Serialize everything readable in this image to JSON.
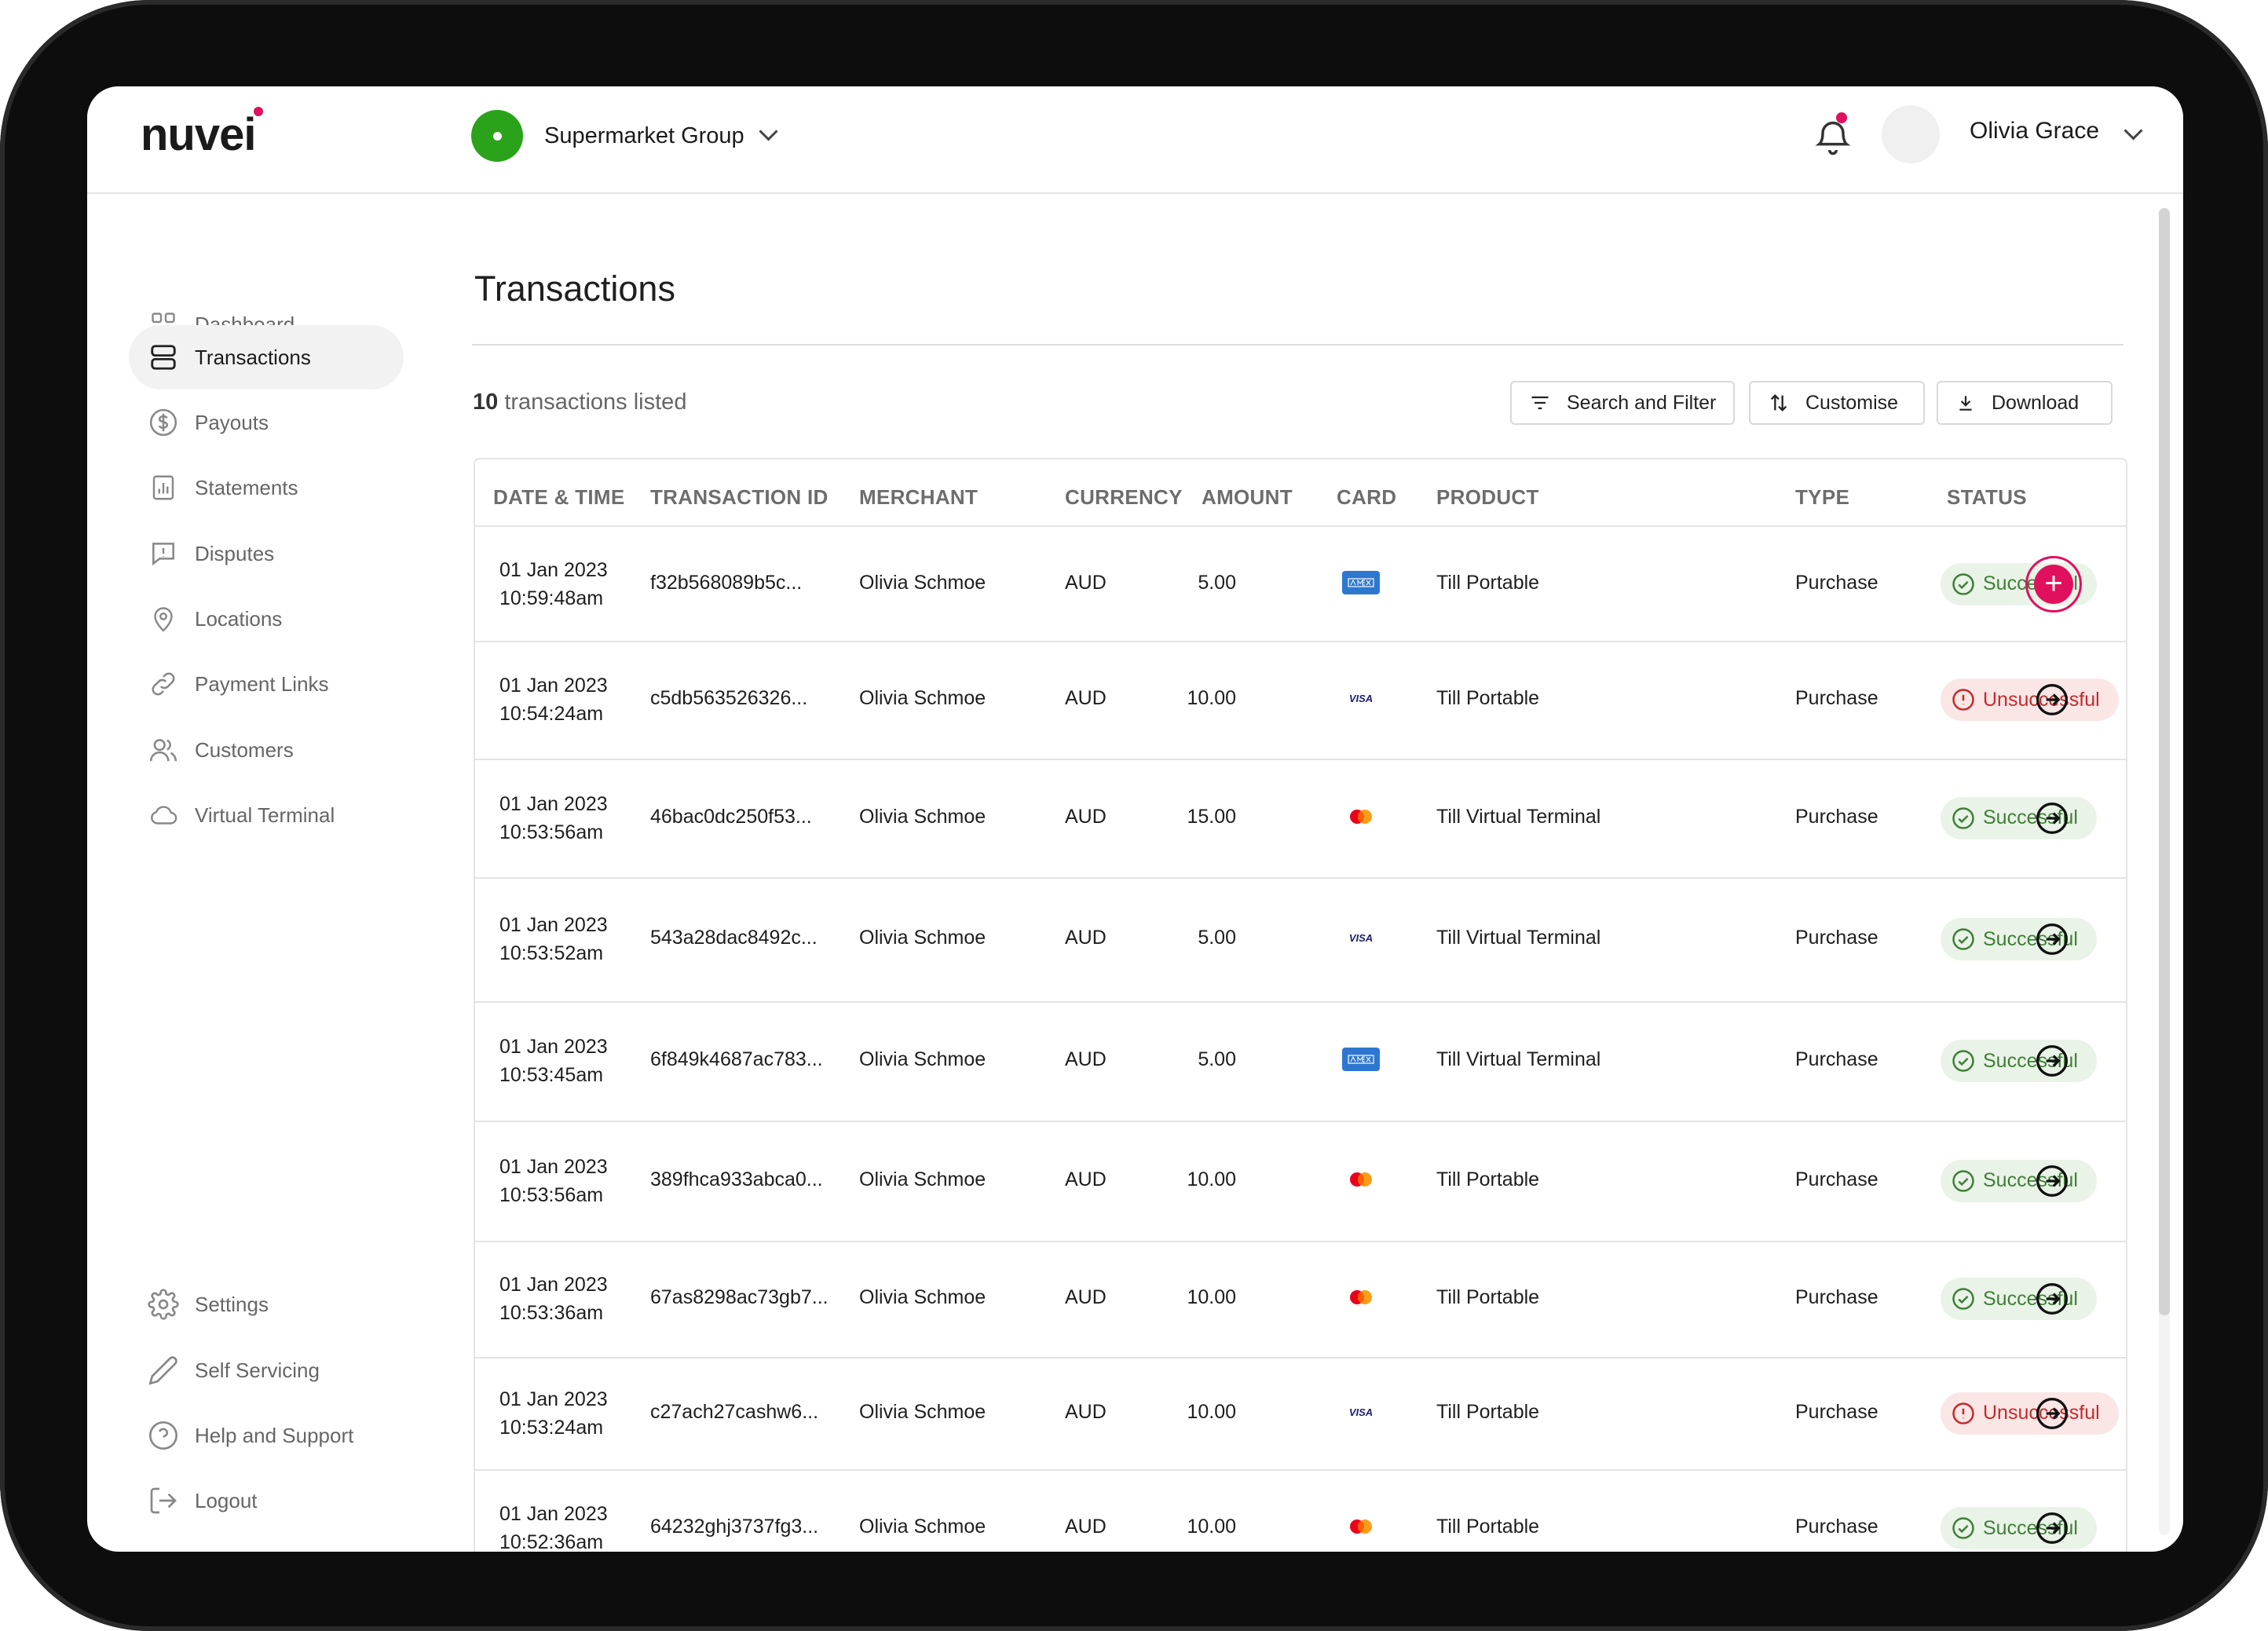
{
  "brand": {
    "logo_text": "nuvei"
  },
  "header": {
    "org_name": "Supermarket Group",
    "user_name": "Olivia Grace"
  },
  "sidebar": {
    "items": [
      {
        "label": "Dashboard",
        "icon": "grid-icon"
      },
      {
        "label": "Transactions",
        "icon": "layers-icon",
        "active": true
      },
      {
        "label": "Payouts",
        "icon": "dollar-circle-icon"
      },
      {
        "label": "Statements",
        "icon": "chart-doc-icon"
      },
      {
        "label": "Disputes",
        "icon": "alert-message-icon"
      },
      {
        "label": "Locations",
        "icon": "map-pin-icon"
      },
      {
        "label": "Payment Links",
        "icon": "link-icon"
      },
      {
        "label": "Customers",
        "icon": "users-icon"
      },
      {
        "label": "Virtual Terminal",
        "icon": "cloud-icon"
      }
    ],
    "bottom_items": [
      {
        "label": "Settings",
        "icon": "gear-icon"
      },
      {
        "label": "Self Servicing",
        "icon": "pencil-icon"
      },
      {
        "label": "Help and Support",
        "icon": "help-circle-icon"
      },
      {
        "label": "Logout",
        "icon": "logout-icon"
      }
    ]
  },
  "main": {
    "title": "Transactions",
    "count_number": "10",
    "count_suffix": "transactions listed",
    "buttons": {
      "filter": "Search and Filter",
      "customise": "Customise",
      "download": "Download"
    }
  },
  "table": {
    "headers": [
      "DATE & TIME",
      "TRANSACTION ID",
      "MERCHANT",
      "CURRENCY",
      "AMOUNT",
      "CARD",
      "PRODUCT",
      "TYPE",
      "STATUS"
    ],
    "rows": [
      {
        "date": "01 Jan 2023",
        "time": "10:59:48am",
        "id": "f32b568089b5c...",
        "merchant": "Olivia Schmoe",
        "currency": "AUD",
        "amount": "5.00",
        "card": "amex",
        "product": "Till Portable",
        "type": "Purchase",
        "status": "Successful",
        "status_kind": "ok"
      },
      {
        "date": "01 Jan 2023",
        "time": "10:54:24am",
        "id": "c5db563526326...",
        "merchant": "Olivia Schmoe",
        "currency": "AUD",
        "amount": "10.00",
        "card": "visa",
        "product": "Till Portable",
        "type": "Purchase",
        "status": "Unsuccessful",
        "status_kind": "bad"
      },
      {
        "date": "01 Jan 2023",
        "time": "10:53:56am",
        "id": "46bac0dc250f53...",
        "merchant": "Olivia Schmoe",
        "currency": "AUD",
        "amount": "15.00",
        "card": "mastercard",
        "product": "Till Virtual Terminal",
        "type": "Purchase",
        "status": "Successful",
        "status_kind": "ok"
      },
      {
        "date": "01 Jan 2023",
        "time": "10:53:52am",
        "id": "543a28dac8492c...",
        "merchant": "Olivia Schmoe",
        "currency": "AUD",
        "amount": "5.00",
        "card": "visa",
        "product": "Till Virtual Terminal",
        "type": "Purchase",
        "status": "Successful",
        "status_kind": "ok"
      },
      {
        "date": "01 Jan 2023",
        "time": "10:53:45am",
        "id": "6f849k4687ac783...",
        "merchant": "Olivia Schmoe",
        "currency": "AUD",
        "amount": "5.00",
        "card": "amex",
        "product": "Till Virtual Terminal",
        "type": "Purchase",
        "status": "Successful",
        "status_kind": "ok"
      },
      {
        "date": "01 Jan 2023",
        "time": "10:53:56am",
        "id": "389fhca933abca0...",
        "merchant": "Olivia Schmoe",
        "currency": "AUD",
        "amount": "10.00",
        "card": "mastercard",
        "product": "Till Portable",
        "type": "Purchase",
        "status": "Successful",
        "status_kind": "ok"
      },
      {
        "date": "01 Jan 2023",
        "time": "10:53:36am",
        "id": "67as8298ac73gb7...",
        "merchant": "Olivia Schmoe",
        "currency": "AUD",
        "amount": "10.00",
        "card": "mastercard",
        "product": "Till Portable",
        "type": "Purchase",
        "status": "Successful",
        "status_kind": "ok"
      },
      {
        "date": "01 Jan 2023",
        "time": "10:53:24am",
        "id": "c27ach27cashw6...",
        "merchant": "Olivia Schmoe",
        "currency": "AUD",
        "amount": "10.00",
        "card": "visa",
        "product": "Till Portable",
        "type": "Purchase",
        "status": "Unsuccessful",
        "status_kind": "bad"
      },
      {
        "date": "01 Jan 2023",
        "time": "10:52:36am",
        "id": "64232ghj3737fg3...",
        "merchant": "Olivia Schmoe",
        "currency": "AUD",
        "amount": "10.00",
        "card": "mastercard",
        "product": "Till Portable",
        "type": "Purchase",
        "status": "Successful",
        "status_kind": "ok"
      }
    ]
  },
  "colors": {
    "accent": "#e0105e",
    "brand_green": "#2aa31b",
    "success": "#3f7f37",
    "error": "#c42a2a"
  }
}
